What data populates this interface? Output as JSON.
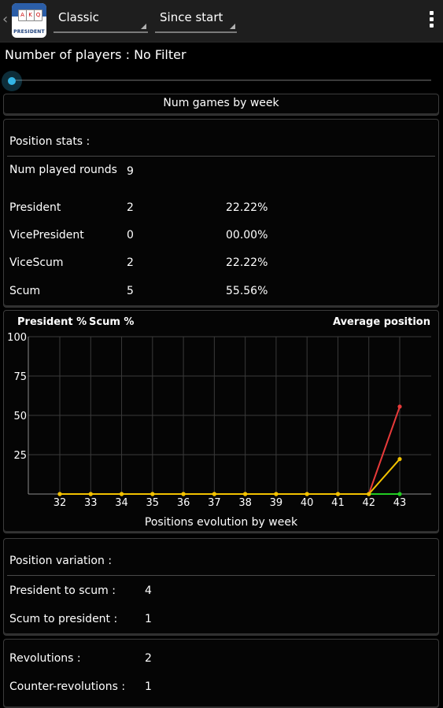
{
  "header": {
    "game_spinner": "Classic",
    "period_spinner": "Since start",
    "app_icon_wordmark": "PRESIDENT",
    "app_icon_cards": [
      "A",
      "K",
      "Q"
    ]
  },
  "filter": {
    "players_label": "Number of players : No Filter"
  },
  "weekly": {
    "title": "Num games by week"
  },
  "position_stats": {
    "title": "Position stats :",
    "rounds_label": "Num played rounds",
    "rounds_value": "9",
    "rows": [
      {
        "label": "President",
        "count": "2",
        "percent": "22.22%"
      },
      {
        "label": "VicePresident",
        "count": "0",
        "percent": "00.00%"
      },
      {
        "label": "ViceScum",
        "count": "2",
        "percent": "22.22%"
      },
      {
        "label": "Scum",
        "count": "5",
        "percent": "55.56%"
      }
    ]
  },
  "chart_data": {
    "type": "line",
    "title": "",
    "xlabel": "Positions evolution by week",
    "ylabel": "",
    "x": [
      "32",
      "33",
      "34",
      "35",
      "36",
      "37",
      "38",
      "39",
      "40",
      "41",
      "42",
      "43"
    ],
    "yticks": [
      100,
      75,
      50,
      25
    ],
    "ylim": [
      0,
      100
    ],
    "grid": true,
    "legend_placement": "top",
    "series": [
      {
        "name": "President %",
        "color": "#22cc22",
        "values": [
          0,
          0,
          0,
          0,
          0,
          0,
          0,
          0,
          0,
          0,
          0,
          0
        ]
      },
      {
        "name": "Scum %",
        "color": "#e83a3a",
        "values": [
          0,
          0,
          0,
          0,
          0,
          0,
          0,
          0,
          0,
          0,
          0,
          55.56
        ]
      },
      {
        "name": "Average position",
        "color": "#f2c200",
        "values": [
          0,
          0,
          0,
          0,
          0,
          0,
          0,
          0,
          0,
          0,
          0,
          22.22
        ]
      }
    ]
  },
  "variation": {
    "title": "Position variation :",
    "rows": [
      {
        "label": "President to scum :",
        "value": "4"
      },
      {
        "label": "Scum to president :",
        "value": "1"
      }
    ]
  },
  "revolutions": {
    "rows": [
      {
        "label": "Revolutions :",
        "value": "2"
      },
      {
        "label": "Counter-revolutions :",
        "value": "1"
      }
    ]
  },
  "colors": {
    "accent": "#33b5e5",
    "president": "#22cc22",
    "scum": "#e83a3a",
    "average": "#f2c200"
  },
  "icons": {
    "back": "chevron-left-icon",
    "overflow": "overflow-menu-icon"
  }
}
